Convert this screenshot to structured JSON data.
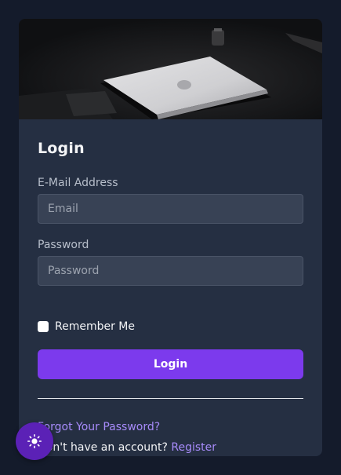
{
  "login": {
    "title": "Login",
    "email_label": "E-Mail Address",
    "email_placeholder": "Email",
    "password_label": "Password",
    "password_placeholder": "Password",
    "remember_label": "Remember Me",
    "submit_label": "Login",
    "forgot_link": "Forgot Your Password?",
    "no_account_text": "Don't have an account? ",
    "register_link": "Register"
  },
  "theme_toggle": {
    "icon": "sun-icon"
  },
  "colors": {
    "page_bg": "#141b2b",
    "card_bg": "#252f42",
    "accent": "#7c3aed",
    "link": "#a78bfa",
    "toggle_bg": "#5b21b6"
  }
}
